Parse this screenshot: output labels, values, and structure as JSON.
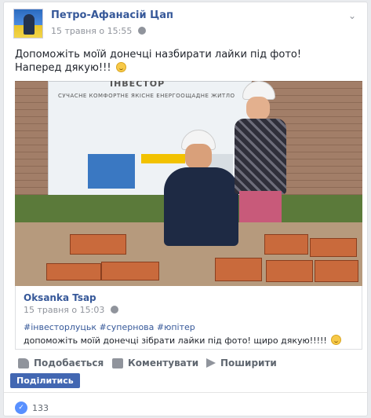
{
  "post": {
    "author": "Петро-Афанасій Цап",
    "date": "15 травня о 15:55",
    "text_line1": "Допоможіть моїй донечці назбирати лайки під фото!",
    "text_line2": "Наперед дякую!!!",
    "image": {
      "banner_title": "ІНВЕСТОР",
      "banner_row1": "СУЧАСНЕ   КОМФОРТНЕ   ЯКІСНЕ   ЕНЕРГООЩАДНЕ   ЖИТЛО"
    }
  },
  "shared": {
    "author": "Oksanka Tsap",
    "date": "15 травня о 15:03",
    "tags": "#інвесторлуцьк #супернова #юпітер",
    "text": "допоможіть моїй донечці зібрати лайки під фото! щиро дякую!!!!!"
  },
  "actions": {
    "like": "Подобається",
    "comment": "Коментувати",
    "share": "Поширити",
    "share_button": "Поділитись"
  },
  "reactions": {
    "count": "133"
  },
  "colors": {
    "link": "#365899",
    "button": "#4267b2",
    "like_badge": "#5890ff"
  }
}
